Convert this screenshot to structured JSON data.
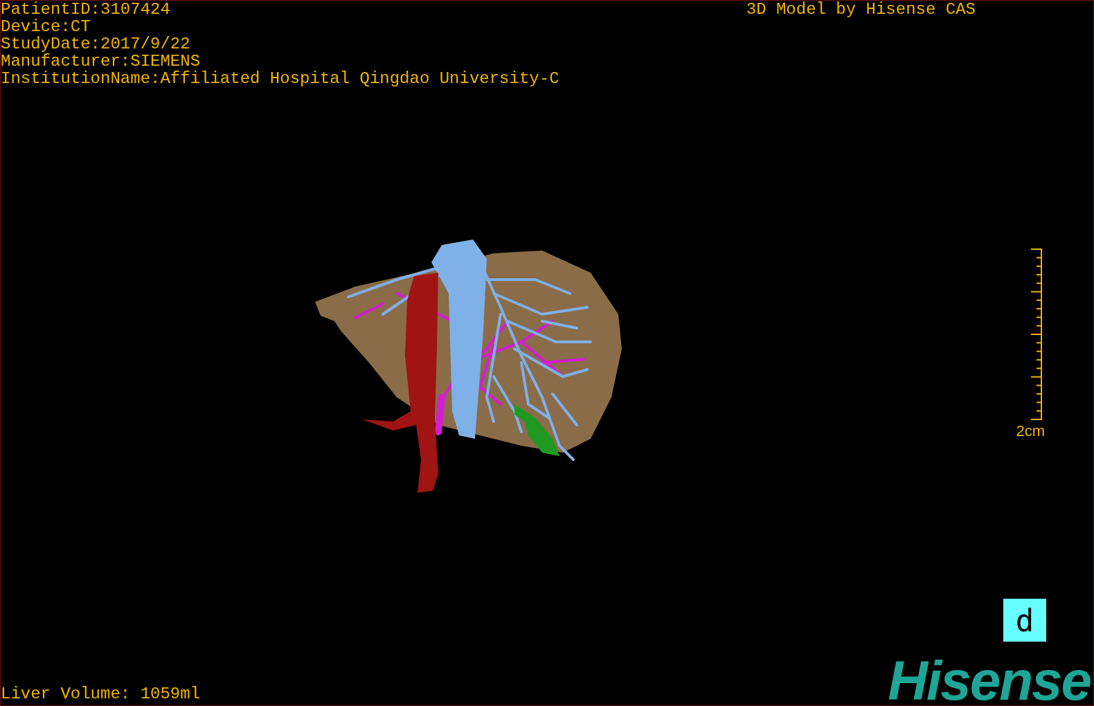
{
  "patient_info": [
    "PatientID:3107424",
    "Device:CT",
    "StudyDate:2017/9/22",
    "Manufacturer:SIEMENS",
    "InstitutionName:Affiliated Hospital Qingdao University-C"
  ],
  "title": "3D Model by Hisense CAS",
  "scale_bar": {
    "label": "2cm"
  },
  "liver_volume": "Liver Volume: 1059ml",
  "orientation_marker": "d",
  "logo": "Hisense"
}
